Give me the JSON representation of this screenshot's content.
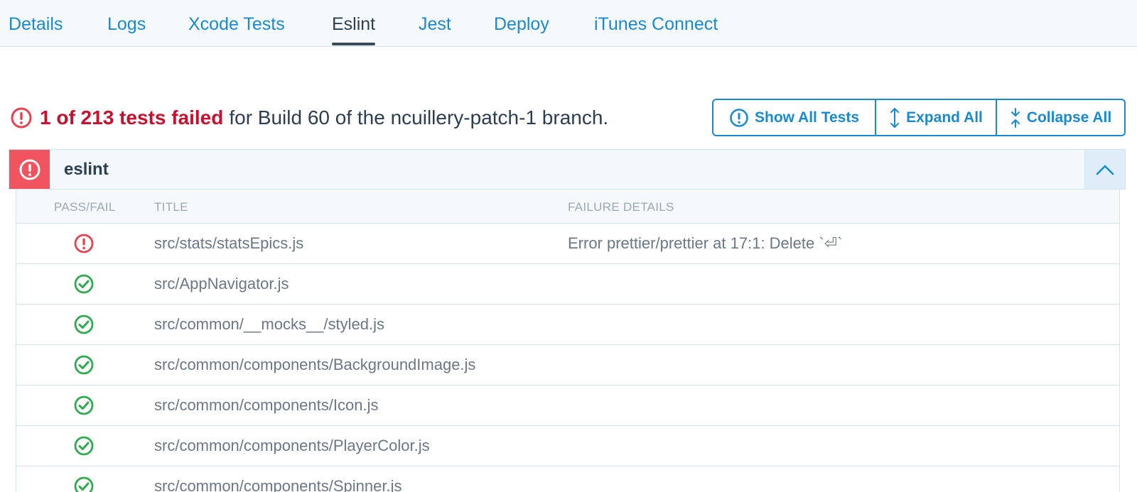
{
  "tabs": [
    {
      "label": "Details"
    },
    {
      "label": "Logs"
    },
    {
      "label": "Xcode Tests"
    },
    {
      "label": "Eslint",
      "active": true
    },
    {
      "label": "Jest"
    },
    {
      "label": "Deploy"
    },
    {
      "label": "iTunes Connect"
    }
  ],
  "summary": {
    "fail_text": "1 of 213 tests failed",
    "rest_text": "for Build 60 of the ncuillery-patch-1 branch.",
    "icon": "alert-circle-icon"
  },
  "buttons": {
    "show_all": "Show All Tests",
    "expand_all": "Expand All",
    "collapse_all": "Collapse All"
  },
  "suite": {
    "name": "eslint",
    "status": "fail"
  },
  "table": {
    "headers": {
      "pass_fail": "PASS/FAIL",
      "title": "TITLE",
      "failure_details": "FAILURE DETAILS"
    },
    "rows": [
      {
        "status": "fail",
        "title": "src/stats/statsEpics.js",
        "details": "Error prettier/prettier at 17:1: Delete `⏎`"
      },
      {
        "status": "pass",
        "title": "src/AppNavigator.js",
        "details": ""
      },
      {
        "status": "pass",
        "title": "src/common/__mocks__/styled.js",
        "details": ""
      },
      {
        "status": "pass",
        "title": "src/common/components/BackgroundImage.js",
        "details": ""
      },
      {
        "status": "pass",
        "title": "src/common/components/Icon.js",
        "details": ""
      },
      {
        "status": "pass",
        "title": "src/common/components/PlayerColor.js",
        "details": ""
      },
      {
        "status": "pass",
        "title": "src/common/components/Spinner.js",
        "details": ""
      }
    ]
  },
  "colors": {
    "accent": "#1a8ad0",
    "fail": "#c8102e",
    "fail_icon": "#e8414f",
    "pass": "#2eab4f",
    "text": "#2c3e50",
    "muted": "#6b7785"
  }
}
